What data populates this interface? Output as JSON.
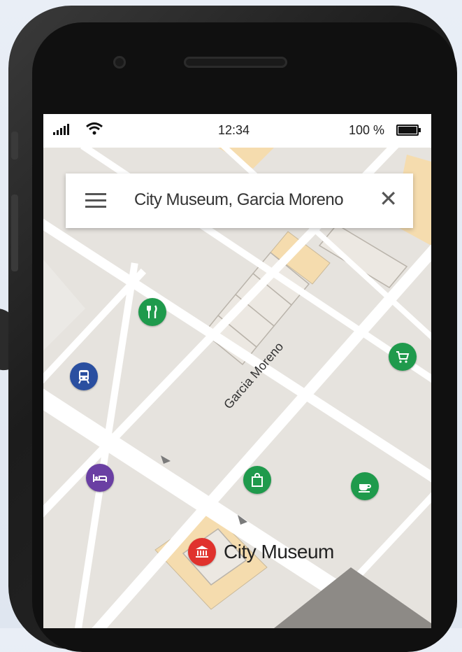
{
  "status_bar": {
    "time": "12:34",
    "battery": "100 %",
    "battery_level": 1.0
  },
  "search": {
    "query": "City Museum, Garcia Moreno",
    "menu_icon": "hamburger-menu-icon",
    "close_icon": "close-icon"
  },
  "map": {
    "street_label": "Garcia Moreno",
    "selected_place": "City Museum",
    "pois": [
      {
        "name": "restaurant",
        "icon": "fork-knife-icon",
        "color": "#1f9a4c"
      },
      {
        "name": "transit",
        "icon": "bus-icon",
        "color": "#2a4fa0"
      },
      {
        "name": "shopping",
        "icon": "shopping-cart-icon",
        "color": "#1f9a4c"
      },
      {
        "name": "hotel",
        "icon": "bed-icon",
        "color": "#6a3fa3"
      },
      {
        "name": "store",
        "icon": "shopping-bag-icon",
        "color": "#1f9a4c"
      },
      {
        "name": "cafe",
        "icon": "coffee-cup-icon",
        "color": "#1f9a4c"
      },
      {
        "name": "museum",
        "icon": "museum-icon",
        "color": "#e0322d"
      }
    ]
  },
  "colors": {
    "map_background": "#e6e3de",
    "road": "#ffffff",
    "building_highlight": "#f5dcae"
  }
}
